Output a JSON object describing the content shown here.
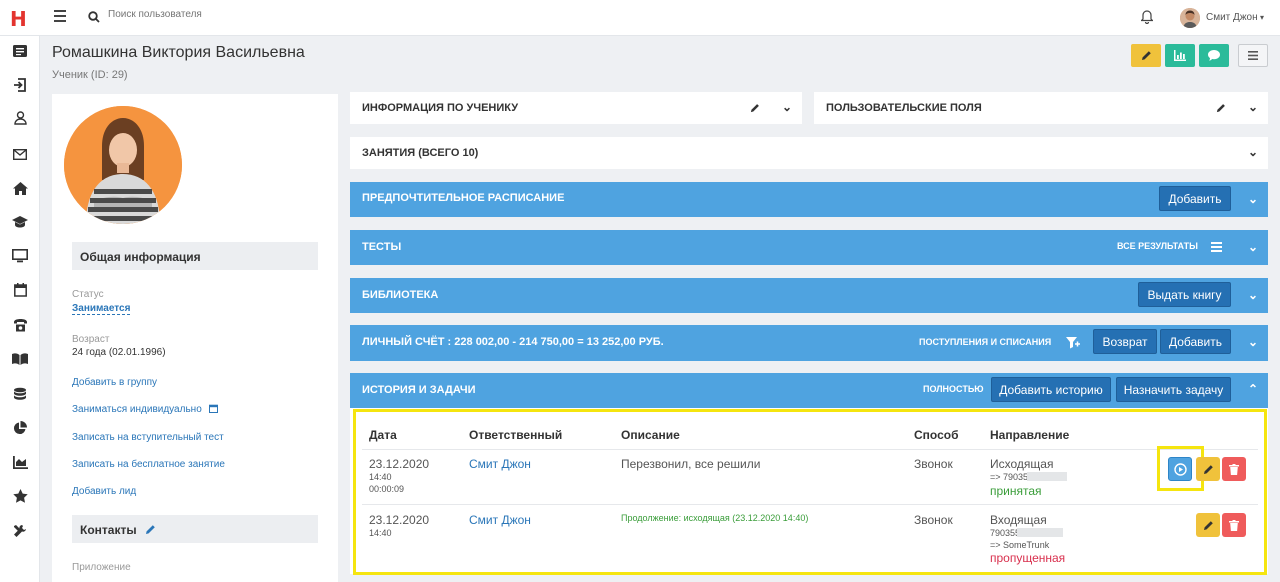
{
  "topbar": {
    "logo": "H",
    "search_placeholder": "Поиск пользователя",
    "user_name": "Смит Джон"
  },
  "sidebar": {
    "icons": [
      "list-icon",
      "login-icon",
      "user-icon",
      "mail-icon",
      "home-icon",
      "graduation-cap-icon",
      "monitor-icon",
      "calendar-icon",
      "phone-icon",
      "book-icon",
      "coins-icon",
      "pie-chart-icon",
      "area-chart-icon",
      "star-icon",
      "tools-icon"
    ]
  },
  "student": {
    "name": "Ромашкина Виктория Васильевна",
    "subtitle": "Ученик (ID: 29)"
  },
  "left": {
    "general_header": "Общая информация",
    "status_label": "Статус",
    "status_value": "Занимается",
    "age_label": "Возраст",
    "age_value": "24 года (02.01.1996)",
    "links": [
      "Добавить в группу",
      "Заниматься индивидуально",
      "Записать на вступительный тест",
      "Записать на бесплатное занятие",
      "Добавить лид"
    ],
    "contacts_header": "Контакты",
    "app_label": "Приложение"
  },
  "panels": {
    "student_info": "ИНФОРМАЦИЯ ПО УЧЕНИКУ",
    "custom_fields": "ПОЛЬЗОВАТЕЛЬСКИЕ ПОЛЯ",
    "lessons": "ЗАНЯТИЯ (ВСЕГО 10)",
    "schedule": "ПРЕДПОЧТИТЕЛЬНОЕ РАСПИСАНИЕ",
    "schedule_btn": "Добавить",
    "tests": "ТЕСТЫ",
    "tests_all": "ВСЕ РЕЗУЛЬТАТЫ",
    "library": "БИБЛИОТЕКА",
    "library_btn": "Выдать книгу",
    "account": "ЛИЧНЫЙ СЧЁТ :  228 002,00 - 214 750,00 = 13 252,00 РУБ.",
    "account_flow": "ПОСТУПЛЕНИЯ И СПИСАНИЯ",
    "account_refund": "Возврат",
    "account_add": "Добавить",
    "history": "ИСТОРИЯ И ЗАДАЧИ",
    "history_full": "ПОЛНОСТЬЮ",
    "history_add": "Добавить историю",
    "history_task": "Назначить задачу"
  },
  "history_table": {
    "headers": [
      "Дата",
      "Ответственный",
      "Описание",
      "Способ",
      "Направление"
    ],
    "rows": [
      {
        "date": "23.12.2020",
        "time": "14:40",
        "duration": "00:00:09",
        "responsible": "Смит Джон",
        "description": "Перезвонил, все решили",
        "method": "Звонок",
        "direction": "Исходящая",
        "number": "=> 790355",
        "status": "принятая"
      },
      {
        "date": "23.12.2020",
        "time": "14:40",
        "responsible": "Смит Джон",
        "description": "Продолжение: исходящая (23.12.2020 14:40)",
        "method": "Звонок",
        "direction": "Входящая",
        "number": "790355",
        "trunk": "=> SomeTrunk",
        "status": "пропущенная"
      }
    ]
  },
  "colors": {
    "panel_blue": "#4fa3e0",
    "button_blue": "#2570b3",
    "highlight": "#f5e50f",
    "edit_yellow": "#f0c23b",
    "delete_red": "#ef5b5b",
    "teal": "#2bbb9a",
    "photo_orange": "#f5943f"
  }
}
